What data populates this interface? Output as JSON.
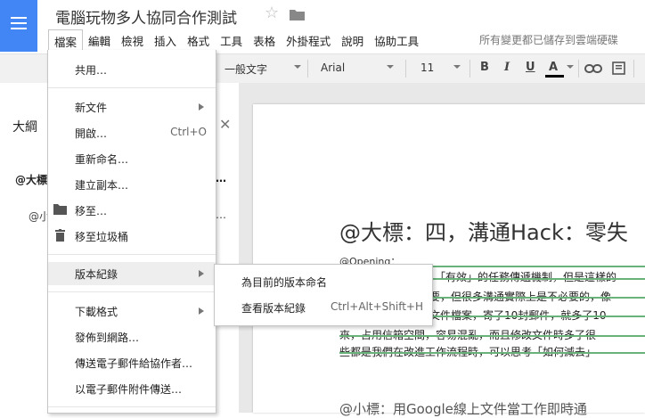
{
  "header": {
    "title": "電腦玩物多人協同合作測試",
    "save_status": "所有變更都已儲存到雲端硬碟"
  },
  "menubar": [
    {
      "label": "檔案"
    },
    {
      "label": "編輯"
    },
    {
      "label": "檢視"
    },
    {
      "label": "插入"
    },
    {
      "label": "格式"
    },
    {
      "label": "工具"
    },
    {
      "label": "表格"
    },
    {
      "label": "外掛程式"
    },
    {
      "label": "說明"
    },
    {
      "label": "協助工具"
    }
  ],
  "toolbar": {
    "style": "一般文字",
    "font": "Arial",
    "size": "11",
    "bold": "B",
    "italic": "I",
    "underline": "U",
    "text_color": "A",
    "text_color_value": "#000000"
  },
  "outline": {
    "title": "大綱",
    "h1": "@大標",
    "h1_tail": "…",
    "h2": "@小",
    "h2_tail": "…"
  },
  "document": {
    "h1": "@大標：四，溝通Hack：零失",
    "opening": "@Opening：",
    "lines": [
      "「有效」的任務傳遞機制，但是這樣的",
      "要，但很多溝通實際上是不必要的，像",
      "文件檔案，寄了10封郵件，就多了10",
      "來，占用信箱空間，容易混亂，而且修改文件時多了很",
      "些都是我們在改進工作流程時，可以思考「如何減去」"
    ],
    "h2": "@小標：用Google線上文件當工作即時通"
  },
  "file_menu": {
    "items": [
      {
        "label": "共用…",
        "shortcut": "",
        "arrow": false,
        "icon": ""
      },
      {
        "label": "新文件",
        "shortcut": "",
        "arrow": true,
        "icon": ""
      },
      {
        "label": "開啟…",
        "shortcut": "Ctrl+O",
        "arrow": false,
        "icon": ""
      },
      {
        "label": "重新命名…",
        "shortcut": "",
        "arrow": false,
        "icon": ""
      },
      {
        "label": "建立副本…",
        "shortcut": "",
        "arrow": false,
        "icon": ""
      },
      {
        "label": "移至…",
        "shortcut": "",
        "arrow": false,
        "icon": "folder-icon"
      },
      {
        "label": "移至垃圾桶",
        "shortcut": "",
        "arrow": false,
        "icon": "trash-icon"
      },
      {
        "label": "版本紀錄",
        "shortcut": "",
        "arrow": true,
        "icon": ""
      },
      {
        "label": "下載格式",
        "shortcut": "",
        "arrow": true,
        "icon": ""
      },
      {
        "label": "發佈到網路…",
        "shortcut": "",
        "arrow": false,
        "icon": ""
      },
      {
        "label": "傳送電子郵件給協作者…",
        "shortcut": "",
        "arrow": false,
        "icon": ""
      },
      {
        "label": "以電子郵件附件傳送…",
        "shortcut": "",
        "arrow": false,
        "icon": ""
      }
    ]
  },
  "version_submenu": {
    "items": [
      {
        "label": "為目前的版本命名",
        "shortcut": ""
      },
      {
        "label": "查看版本紀錄",
        "shortcut": "Ctrl+Alt+Shift+H"
      }
    ]
  },
  "colors": {
    "brand": "#4285f4",
    "strike": "#69b37a",
    "menu_highlight": "#eeeeee"
  }
}
